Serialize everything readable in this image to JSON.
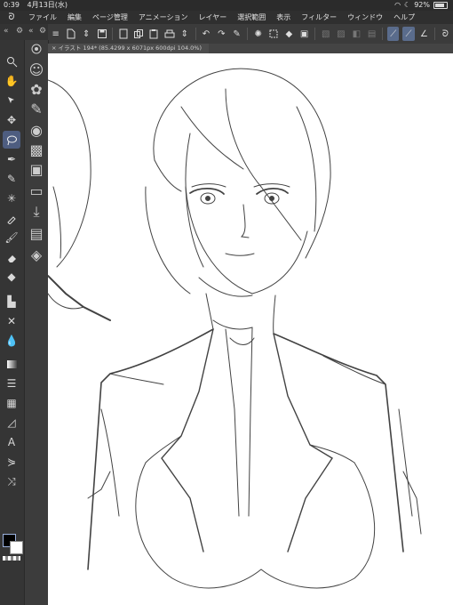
{
  "status": {
    "time": "0:39",
    "date": "4月13日(水)",
    "battery": "92%"
  },
  "menu": {
    "items": [
      "ファイル",
      "編集",
      "ページ管理",
      "アニメーション",
      "レイヤー",
      "選択範囲",
      "表示",
      "フィルター",
      "ウィンドウ",
      "ヘルプ"
    ]
  },
  "document": {
    "tab_title": "イラスト 194* (85.4299 x 6071px 600dpi 104.0%)"
  },
  "tools": [
    "zoom-icon",
    "hand-icon",
    "operation-icon",
    "move-icon",
    "lasso-icon",
    "pen-icon",
    "pencil-icon",
    "airbrush-icon",
    "eyedropper-icon",
    "brush-icon",
    "eraser-icon",
    "fill-icon",
    "gradient-icon",
    "figure-icon",
    "text-icon",
    "balloon-icon",
    "ruler-icon",
    "correction-icon"
  ],
  "colors": {
    "main": "#000000",
    "sub": "#ffffff",
    "active_tool_bg": "#4e5d80"
  }
}
